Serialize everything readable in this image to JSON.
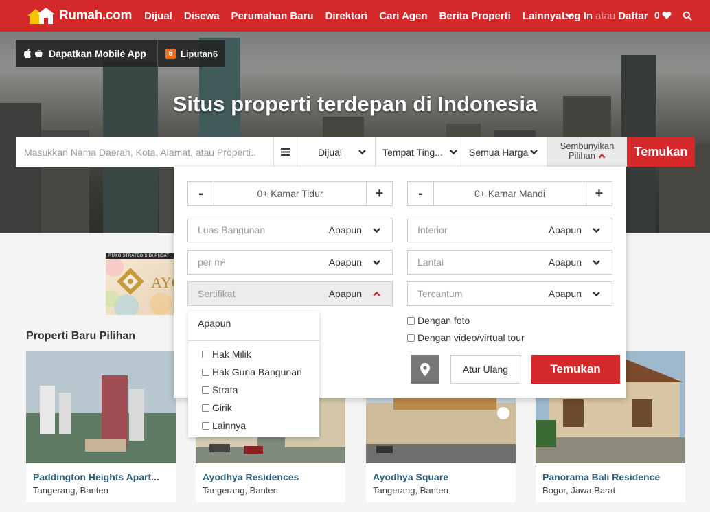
{
  "nav": {
    "logo_text": "Rumah.com",
    "links": [
      "Dijual",
      "Disewa",
      "Perumahan Baru",
      "Direktori",
      "Cari Agen",
      "Berita Properti"
    ],
    "more_label": "Lainnya",
    "login_label": "Log In",
    "or_label": "atau",
    "register_label": "Daftar",
    "favorites_count": "0"
  },
  "hero": {
    "app_button_label": "Dapatkan Mobile App",
    "partner_label": "Liputan6",
    "partner_mark": "6",
    "title": "Situs properti terdepan di Indonesia"
  },
  "search": {
    "placeholder": "Masukkan Nama Daerah, Kota, Alamat, atau Properti..",
    "listing_type": "Dijual",
    "property_type": "Tempat Ting...",
    "price": "Semua Harga",
    "hide_label_line1": "Sembunyikan",
    "hide_label_line2": "Pilihan",
    "submit_label": "Temukan"
  },
  "filters": {
    "bedrooms_label": "0+ Kamar Tidur",
    "bathrooms_label": "0+ Kamar Mandi",
    "minus": "-",
    "plus": "+",
    "dropdowns_left": [
      {
        "label": "Luas Bangunan",
        "value": "Apapun"
      },
      {
        "label": "per m²",
        "value": "Apapun"
      },
      {
        "label": "Sertifikat",
        "value": "Apapun"
      }
    ],
    "dropdowns_right": [
      {
        "label": "Interior",
        "value": "Apapun"
      },
      {
        "label": "Lantai",
        "value": "Apapun"
      },
      {
        "label": "Tercantum",
        "value": "Apapun"
      }
    ],
    "with_photo": "Dengan foto",
    "with_video": "Dengan video/virtual tour",
    "reset_label": "Atur Ulang",
    "submit_label": "Temukan"
  },
  "certificate_options": {
    "any": "Apapun",
    "items": [
      "Hak Milik",
      "Hak Guna Bangunan",
      "Strata",
      "Girik",
      "Lainnya"
    ]
  },
  "ad": {
    "headline": "RUKO STRATEGIS DI PUSAT",
    "brand": "AYO"
  },
  "section_title": "Properti Baru Pilihan",
  "cards": [
    {
      "title": "Paddington Heights Apart...",
      "location": "Tangerang, Banten"
    },
    {
      "title": "Ayodhya Residences",
      "location": "Tangerang, Banten"
    },
    {
      "title": "Ayodhya Square",
      "location": "Tangerang, Banten"
    },
    {
      "title": "Panorama Bali Residence",
      "location": "Bogor, Jawa Barat"
    }
  ],
  "colors": {
    "brand_red": "#d4282a",
    "link_blue": "#2d5f7f"
  },
  "icons": [
    "house-logo-icon",
    "apple-icon",
    "android-icon",
    "heart-icon",
    "search-icon",
    "menu-icon",
    "chevron-down-icon",
    "chevron-up-icon",
    "map-pin-icon"
  ]
}
